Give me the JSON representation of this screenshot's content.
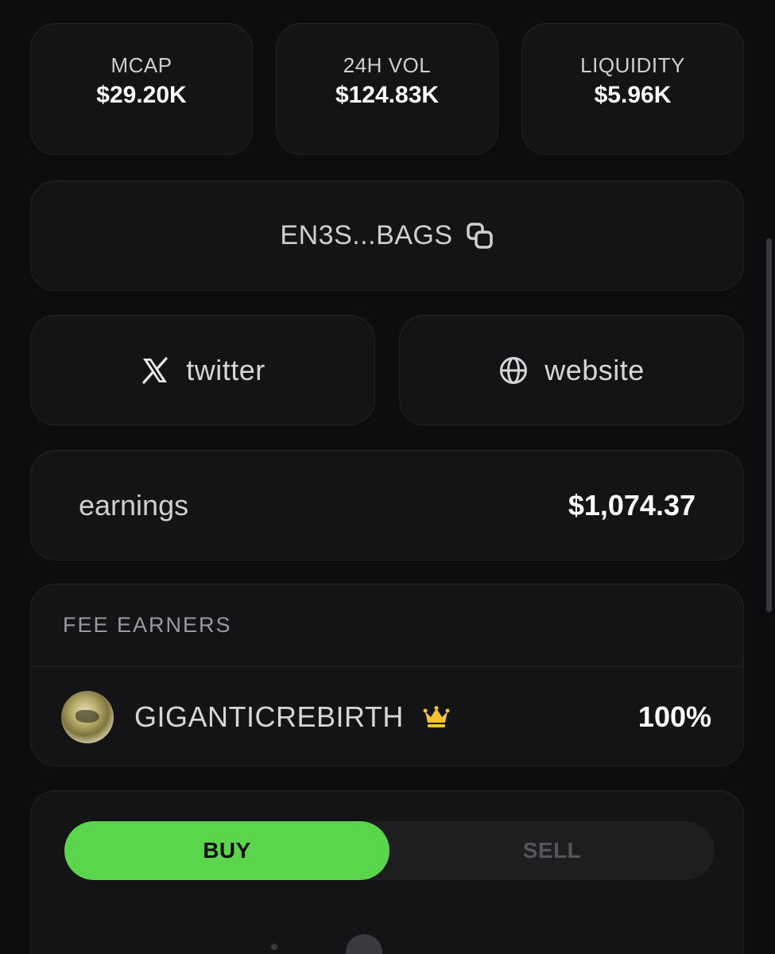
{
  "stats": [
    {
      "label": "MCAP",
      "value": "$29.20K"
    },
    {
      "label": "24H VOL",
      "value": "$124.83K"
    },
    {
      "label": "LIQUIDITY",
      "value": "$5.96K"
    }
  ],
  "address": {
    "text": "EN3S...BAGS",
    "icon": "copy-icon"
  },
  "links": {
    "twitter": {
      "label": "twitter",
      "icon": "x-icon"
    },
    "website": {
      "label": "website",
      "icon": "globe-icon"
    }
  },
  "earnings": {
    "label": "earnings",
    "value": "$1,074.37"
  },
  "fee_earners": {
    "title": "FEE EARNERS",
    "rows": [
      {
        "name": "GIGANTICREBIRTH",
        "badge_icon": "crown-icon",
        "percent": "100%"
      }
    ]
  },
  "trade": {
    "buy_label": "BUY",
    "sell_label": "SELL",
    "active": "BUY"
  },
  "colors": {
    "background": "#0d0d0f",
    "card": "#141416",
    "accent_green": "#5bd64c",
    "crown_gold": "#f2c431"
  }
}
